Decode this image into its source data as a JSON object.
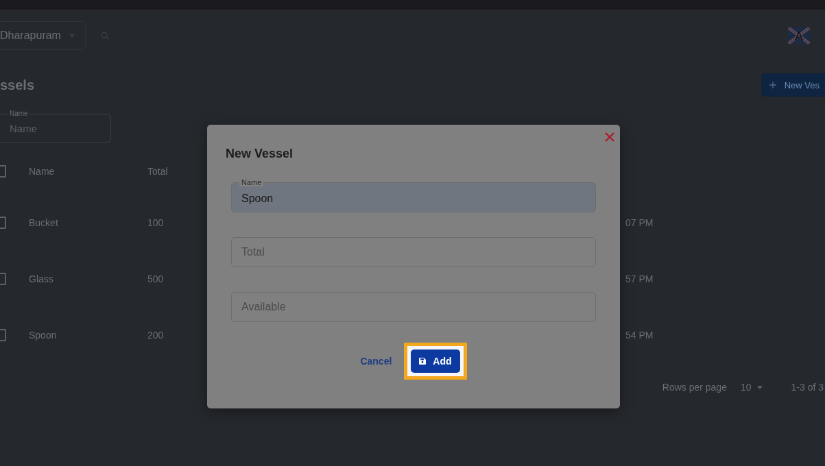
{
  "toolbar": {
    "location": "Dharapuram",
    "language_letter": "A"
  },
  "page": {
    "title": "ssels",
    "new_button": "New Ves"
  },
  "filter": {
    "label": "Name",
    "placeholder": "Name"
  },
  "table": {
    "header_checked": false,
    "columns": [
      "Name",
      "Total"
    ],
    "rows": [
      {
        "checked": false,
        "name": "Bucket",
        "total": "100",
        "time": "07 PM"
      },
      {
        "checked": false,
        "name": "Glass",
        "total": "500",
        "time": "57 PM"
      },
      {
        "checked": false,
        "name": "Spoon",
        "total": "200",
        "time": "54 PM"
      }
    ]
  },
  "pagination": {
    "rows_per_page_label": "Rows per page",
    "rows_per_page": "10",
    "range": "1-3 of 3"
  },
  "dialog": {
    "title": "New Vessel",
    "fields": [
      {
        "label": "Name",
        "value": "Spoon",
        "filled": true
      },
      {
        "placeholder": "Total",
        "filled": false
      },
      {
        "placeholder": "Available",
        "filled": false
      }
    ],
    "cancel": "Cancel",
    "add": "Add",
    "add_highlighted": true
  }
}
